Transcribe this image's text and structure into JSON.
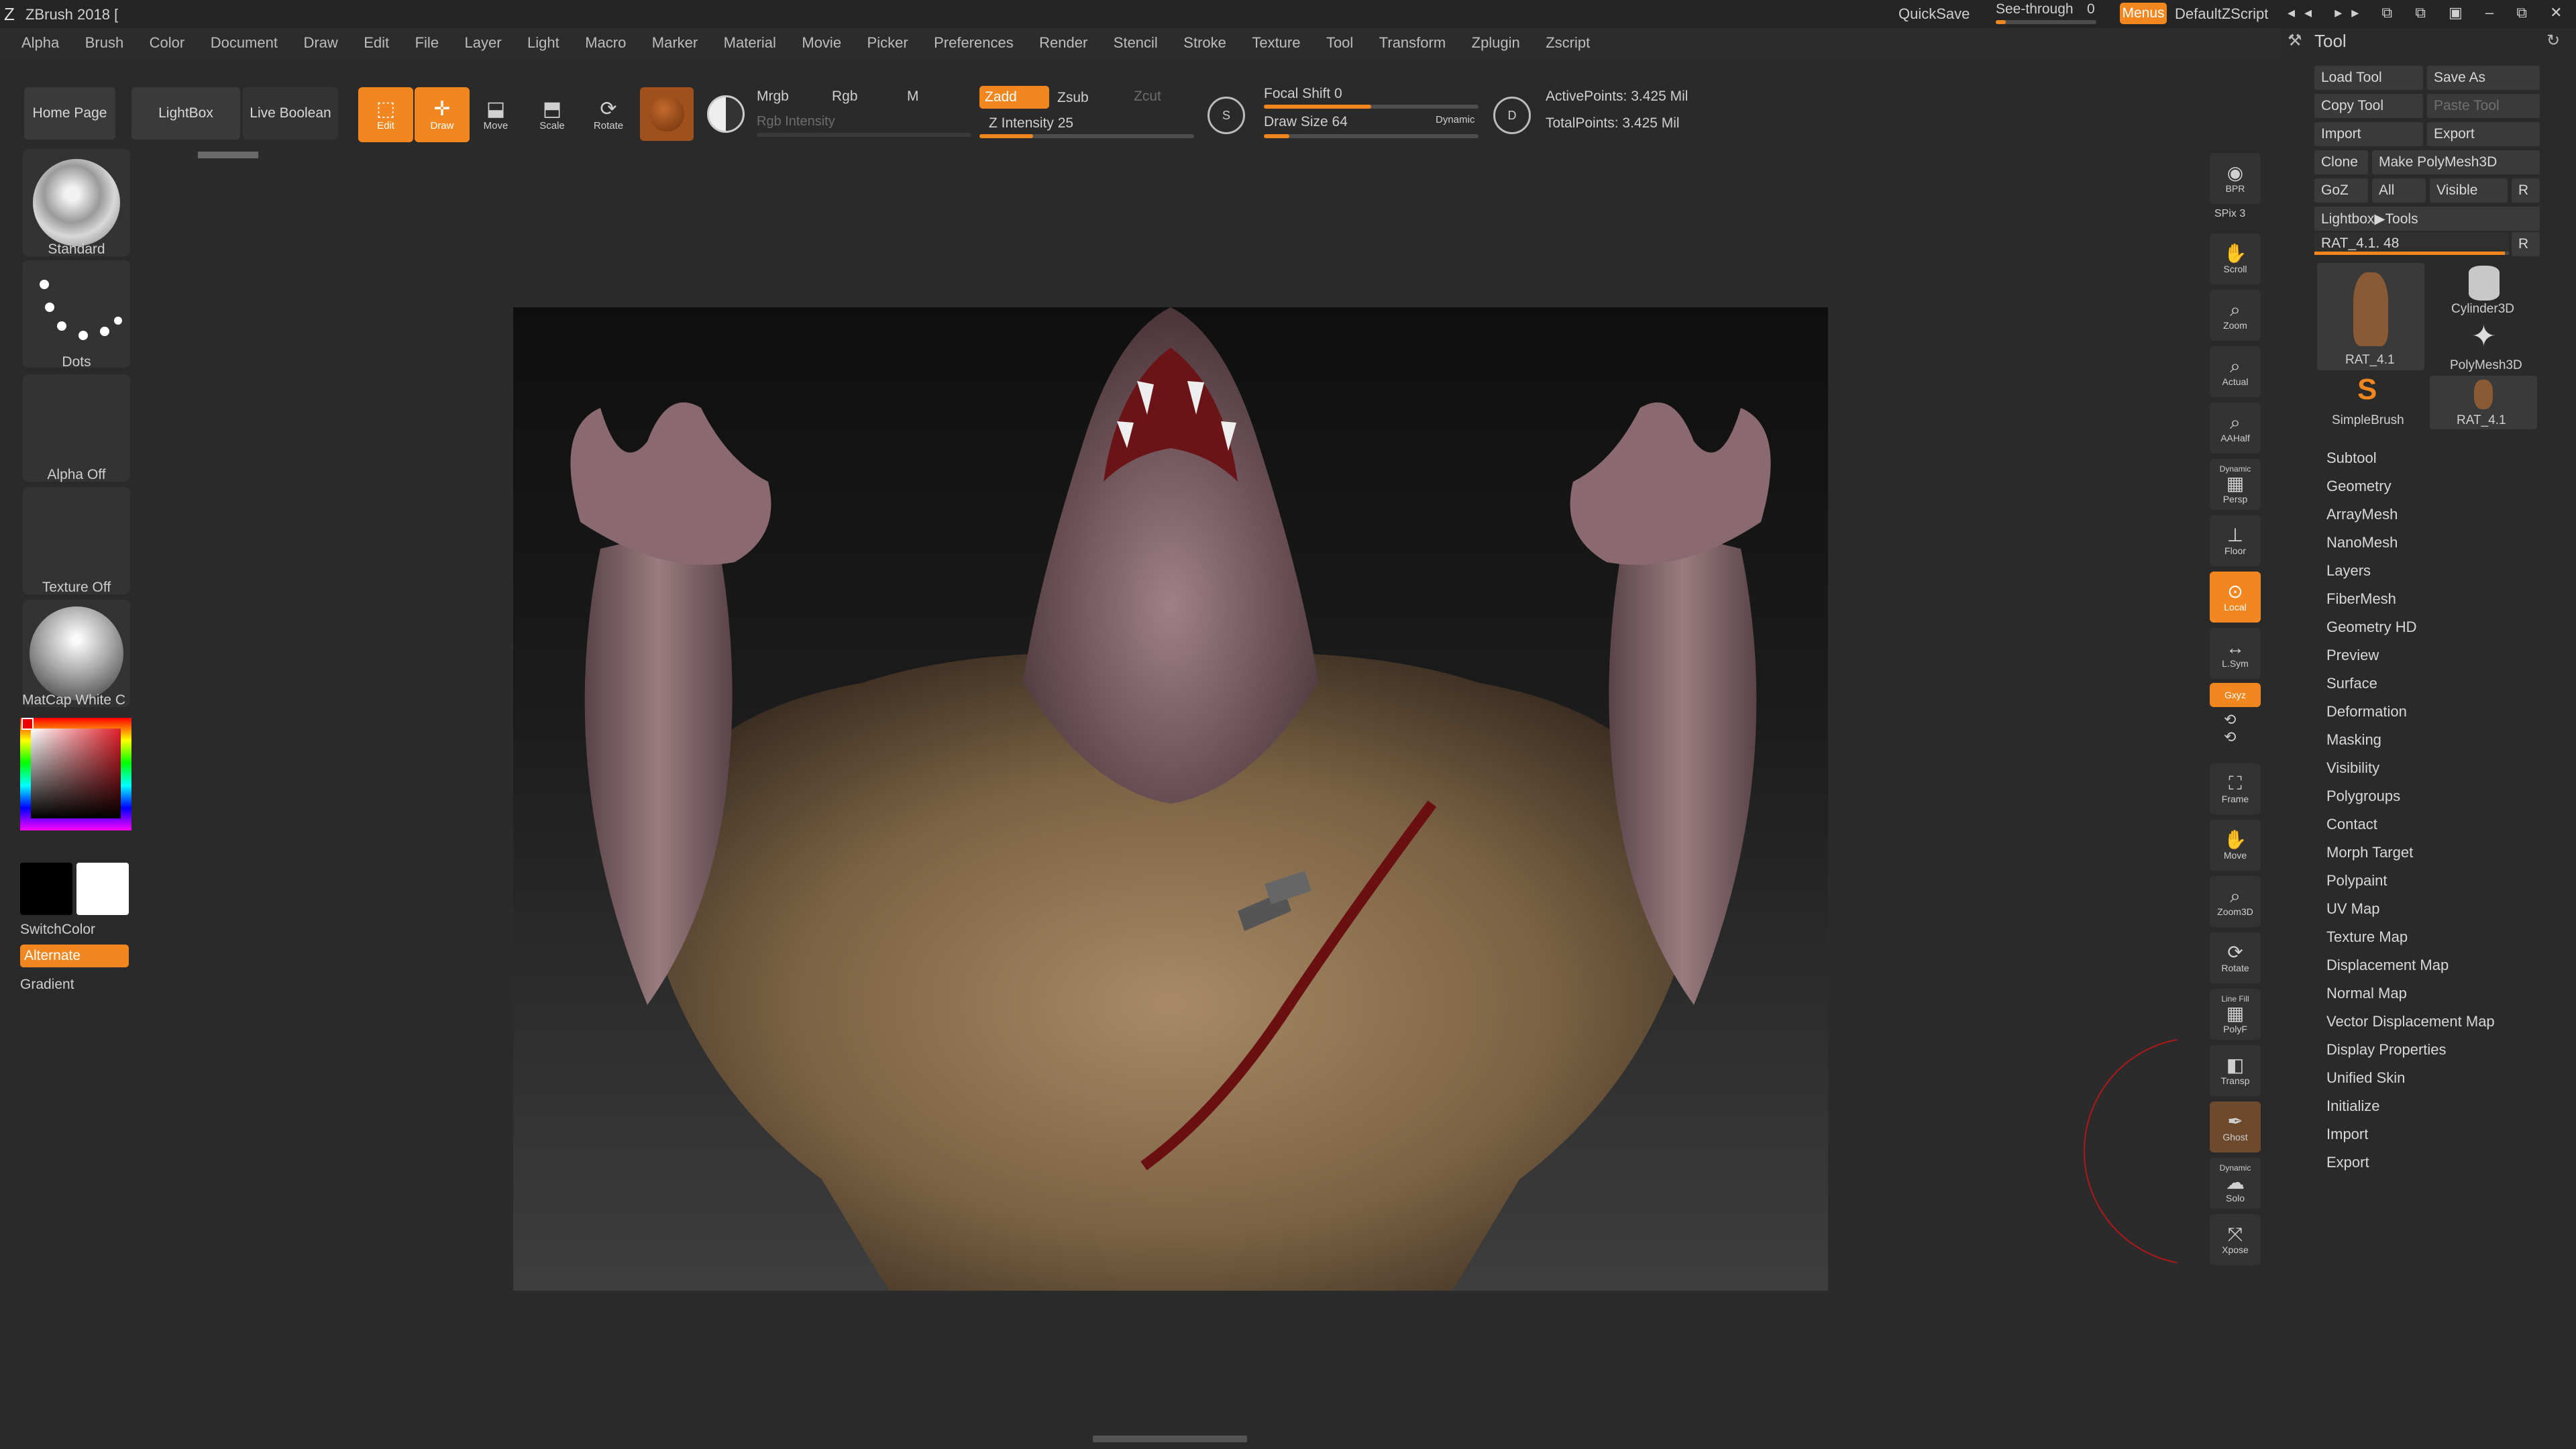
{
  "app": {
    "title": "ZBrush 2018 [",
    "quicksave": "QuickSave",
    "see_through_label": "See-through",
    "see_through_value": "0",
    "menus_label": "Menus",
    "script_label": "DefaultZScript"
  },
  "menu": [
    "Alpha",
    "Brush",
    "Color",
    "Document",
    "Draw",
    "Edit",
    "File",
    "Layer",
    "Light",
    "Macro",
    "Marker",
    "Material",
    "Movie",
    "Picker",
    "Preferences",
    "Render",
    "Stencil",
    "Stroke",
    "Texture",
    "Tool",
    "Transform",
    "Zplugin",
    "Zscript"
  ],
  "shelf": {
    "home_page": "Home Page",
    "lightbox": "LightBox",
    "live_boolean": "Live Boolean",
    "edit": "Edit",
    "draw": "Draw",
    "move": "Move",
    "scale": "Scale",
    "rotate": "Rotate",
    "mrgb": "Mrgb",
    "rgb": "Rgb",
    "m": "M",
    "rgb_intensity": "Rgb Intensity",
    "zadd": "Zadd",
    "zsub": "Zsub",
    "zcut": "Zcut",
    "z_intensity": "Z Intensity 25",
    "focal_shift": "Focal Shift 0",
    "draw_size": "Draw Size 64",
    "dynamic": "Dynamic",
    "active_points": "ActivePoints: 3.425 Mil",
    "total_points": "TotalPoints: 3.425 Mil",
    "z_intensity_value": 25,
    "focal_shift_value": 0,
    "draw_size_value": 64
  },
  "left_tray": {
    "brush": "Standard",
    "stroke": "Dots",
    "alpha": "Alpha Off",
    "texture": "Texture Off",
    "material": "MatCap White C",
    "gradient": "Gradient",
    "switch_color": "SwitchColor",
    "alternate": "Alternate"
  },
  "right_shelf": [
    {
      "name": "bpr",
      "label": "BPR"
    },
    {
      "name": "spix",
      "label": "SPix 3"
    },
    {
      "name": "scroll",
      "label": "Scroll"
    },
    {
      "name": "zoom",
      "label": "Zoom"
    },
    {
      "name": "actual",
      "label": "Actual"
    },
    {
      "name": "aahalf",
      "label": "AAHalf"
    },
    {
      "name": "persp",
      "label": "Persp"
    },
    {
      "name": "dynamic",
      "label": "Dynamic"
    },
    {
      "name": "floor",
      "label": "Floor"
    },
    {
      "name": "local",
      "label": "Local"
    },
    {
      "name": "lsym",
      "label": "L.Sym"
    },
    {
      "name": "xyz",
      "label": "Gxyz"
    },
    {
      "name": "frame",
      "label": "Frame"
    },
    {
      "name": "move",
      "label": "Move"
    },
    {
      "name": "zoom3d",
      "label": "Zoom3D"
    },
    {
      "name": "rotate",
      "label": "Rotate"
    },
    {
      "name": "linefill",
      "label": "Line Fill"
    },
    {
      "name": "polyf",
      "label": "PolyF"
    },
    {
      "name": "transp",
      "label": "Transp"
    },
    {
      "name": "ghost",
      "label": "Ghost"
    },
    {
      "name": "solo",
      "label": "Solo"
    },
    {
      "name": "xpose",
      "label": "Xpose"
    }
  ],
  "tool_panel": {
    "title": "Tool",
    "load_tool": "Load Tool",
    "save_as": "Save As",
    "copy_tool": "Copy Tool",
    "paste_tool": "Paste Tool",
    "import": "Import",
    "export": "Export",
    "clone": "Clone",
    "make_polymesh": "Make PolyMesh3D",
    "goz": "GoZ",
    "all": "All",
    "visible": "Visible",
    "r": "R",
    "lightbox_tools": "Lightbox▶Tools",
    "current_tool": "RAT_4.1. 48",
    "thumbs": [
      "RAT_4.1",
      "Cylinder3D",
      "PolyMesh3D",
      "SimpleBrush",
      "RAT_4.1"
    ],
    "subpalettes": [
      "Subtool",
      "Geometry",
      "ArrayMesh",
      "NanoMesh",
      "Layers",
      "FiberMesh",
      "Geometry HD",
      "Preview",
      "Surface",
      "Deformation",
      "Masking",
      "Visibility",
      "Polygroups",
      "Contact",
      "Morph Target",
      "Polypaint",
      "UV Map",
      "Texture Map",
      "Displacement Map",
      "Normal Map",
      "Vector Displacement Map",
      "Display Properties",
      "Unified Skin",
      "Initialize",
      "Import",
      "Export"
    ]
  },
  "colors": {
    "accent": "#f2871f",
    "bg": "#2a2a2a",
    "panel": "#3a3a3a"
  }
}
